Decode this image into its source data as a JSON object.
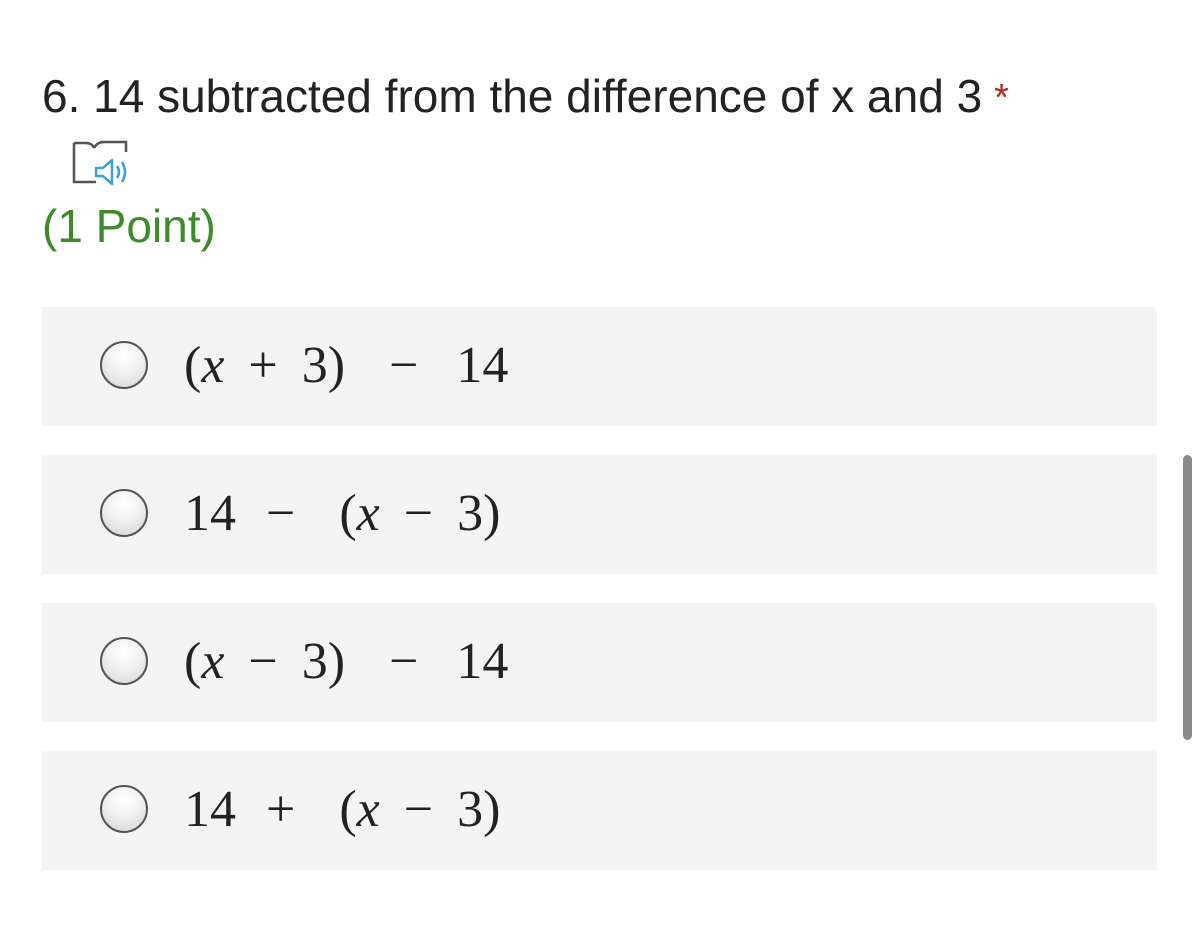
{
  "question": {
    "title": "6. 14 subtracted from the difference of x and 3",
    "required_mark": "*",
    "points": "(1 Point)",
    "immersive_reader_icon": "immersive-reader-icon"
  },
  "options": [
    {
      "id": "a",
      "tokens": [
        {
          "text": "(",
          "italic": false,
          "gap": 0
        },
        {
          "text": "x",
          "italic": true,
          "gap": 0
        },
        {
          "text": "+",
          "italic": false,
          "gap": 24
        },
        {
          "text": "3)",
          "italic": false,
          "gap": 24
        },
        {
          "text": "−",
          "italic": false,
          "gap": 44
        },
        {
          "text": "14",
          "italic": false,
          "gap": 38
        }
      ]
    },
    {
      "id": "b",
      "tokens": [
        {
          "text": "14",
          "italic": false,
          "gap": 0
        },
        {
          "text": "−",
          "italic": false,
          "gap": 30
        },
        {
          "text": "(",
          "italic": false,
          "gap": 44
        },
        {
          "text": "x",
          "italic": true,
          "gap": 0
        },
        {
          "text": "−",
          "italic": false,
          "gap": 24
        },
        {
          "text": "3)",
          "italic": false,
          "gap": 24
        }
      ]
    },
    {
      "id": "c",
      "tokens": [
        {
          "text": "(",
          "italic": false,
          "gap": 0
        },
        {
          "text": "x",
          "italic": true,
          "gap": 0
        },
        {
          "text": "−",
          "italic": false,
          "gap": 24
        },
        {
          "text": "3)",
          "italic": false,
          "gap": 24
        },
        {
          "text": "−",
          "italic": false,
          "gap": 44
        },
        {
          "text": "14",
          "italic": false,
          "gap": 38
        }
      ]
    },
    {
      "id": "d",
      "tokens": [
        {
          "text": "14",
          "italic": false,
          "gap": 0
        },
        {
          "text": "+",
          "italic": false,
          "gap": 30
        },
        {
          "text": "(",
          "italic": false,
          "gap": 44
        },
        {
          "text": "x",
          "italic": true,
          "gap": 0
        },
        {
          "text": "−",
          "italic": false,
          "gap": 24
        },
        {
          "text": "3)",
          "italic": false,
          "gap": 24
        }
      ]
    }
  ],
  "colors": {
    "required": "#b3261e",
    "points": "#3f8a2a",
    "option_background": "#f4f4f4",
    "speaker_icon": "#3aa0d8"
  }
}
